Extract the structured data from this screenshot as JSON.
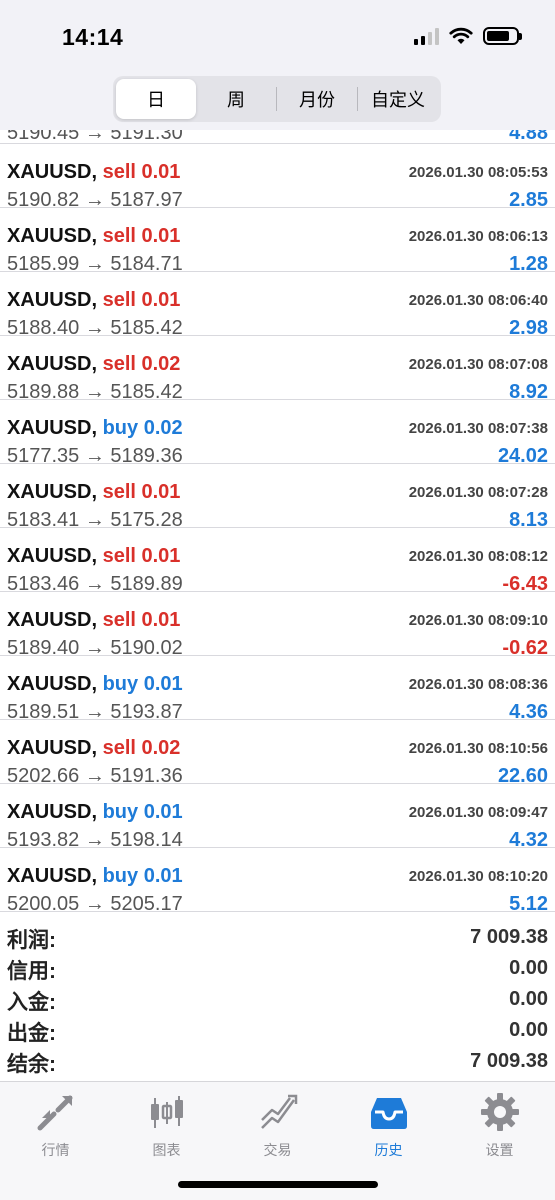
{
  "status_bar": {
    "time": "14:14"
  },
  "period_tabs": [
    "日",
    "周",
    "月份",
    "自定义"
  ],
  "partial_row": {
    "price": "5190.45 → 5191.30",
    "profit": "4.88"
  },
  "trades": [
    {
      "symbol": "XAUUSD,",
      "side": "sell",
      "volume": "0.01",
      "time": "2026.01.30 08:05:53",
      "prices": "5190.82 → 5187.97",
      "profit": "2.85",
      "positive": true
    },
    {
      "symbol": "XAUUSD,",
      "side": "sell",
      "volume": "0.01",
      "time": "2026.01.30 08:06:13",
      "prices": "5185.99 → 5184.71",
      "profit": "1.28",
      "positive": true
    },
    {
      "symbol": "XAUUSD,",
      "side": "sell",
      "volume": "0.01",
      "time": "2026.01.30 08:06:40",
      "prices": "5188.40 → 5185.42",
      "profit": "2.98",
      "positive": true
    },
    {
      "symbol": "XAUUSD,",
      "side": "sell",
      "volume": "0.02",
      "time": "2026.01.30 08:07:08",
      "prices": "5189.88 → 5185.42",
      "profit": "8.92",
      "positive": true
    },
    {
      "symbol": "XAUUSD,",
      "side": "buy",
      "volume": "0.02",
      "time": "2026.01.30 08:07:38",
      "prices": "5177.35 → 5189.36",
      "profit": "24.02",
      "positive": true
    },
    {
      "symbol": "XAUUSD,",
      "side": "sell",
      "volume": "0.01",
      "time": "2026.01.30 08:07:28",
      "prices": "5183.41 → 5175.28",
      "profit": "8.13",
      "positive": true
    },
    {
      "symbol": "XAUUSD,",
      "side": "sell",
      "volume": "0.01",
      "time": "2026.01.30 08:08:12",
      "prices": "5183.46 → 5189.89",
      "profit": "-6.43",
      "positive": false
    },
    {
      "symbol": "XAUUSD,",
      "side": "sell",
      "volume": "0.01",
      "time": "2026.01.30 08:09:10",
      "prices": "5189.40 → 5190.02",
      "profit": "-0.62",
      "positive": false
    },
    {
      "symbol": "XAUUSD,",
      "side": "buy",
      "volume": "0.01",
      "time": "2026.01.30 08:08:36",
      "prices": "5189.51 → 5193.87",
      "profit": "4.36",
      "positive": true
    },
    {
      "symbol": "XAUUSD,",
      "side": "sell",
      "volume": "0.02",
      "time": "2026.01.30 08:10:56",
      "prices": "5202.66 → 5191.36",
      "profit": "22.60",
      "positive": true
    },
    {
      "symbol": "XAUUSD,",
      "side": "buy",
      "volume": "0.01",
      "time": "2026.01.30 08:09:47",
      "prices": "5193.82 → 5198.14",
      "profit": "4.32",
      "positive": true
    },
    {
      "symbol": "XAUUSD,",
      "side": "buy",
      "volume": "0.01",
      "time": "2026.01.30 08:10:20",
      "prices": "5200.05 → 5205.17",
      "profit": "5.12",
      "positive": true
    }
  ],
  "summary": [
    {
      "label": "利润:",
      "value": "7 009.38"
    },
    {
      "label": "信用:",
      "value": "0.00"
    },
    {
      "label": "入金:",
      "value": "0.00"
    },
    {
      "label": "出金:",
      "value": "0.00"
    },
    {
      "label": "结余:",
      "value": "7 009.38"
    }
  ],
  "tabbar": {
    "items": [
      {
        "label": "行情",
        "icon": "quotes-icon"
      },
      {
        "label": "图表",
        "icon": "chart-icon"
      },
      {
        "label": "交易",
        "icon": "trade-icon"
      },
      {
        "label": "历史",
        "icon": "history-icon",
        "active": true
      },
      {
        "label": "设置",
        "icon": "settings-icon"
      }
    ]
  },
  "colors": {
    "sell": "#d9302a",
    "buy": "#1e7bd8",
    "profit_positive": "#1e7bd8",
    "profit_negative": "#d9302a",
    "tab_active": "#1e7bd8",
    "tab_inactive": "#8c8c91"
  }
}
